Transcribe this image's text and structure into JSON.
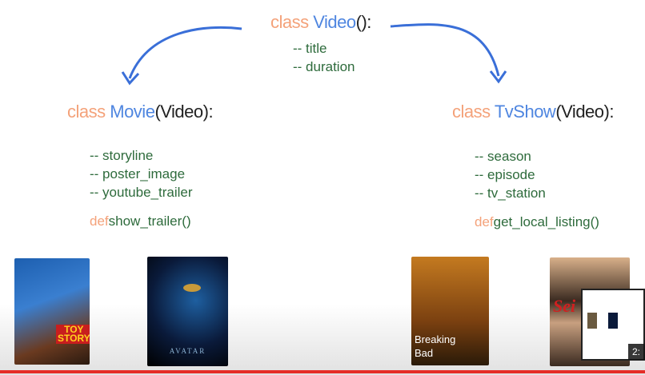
{
  "slide": {
    "video_class": {
      "keyword": "class",
      "name": "Video",
      "suffix": "():",
      "attributes": [
        "-- title",
        "-- duration"
      ]
    },
    "movie_class": {
      "keyword": "class",
      "name": "Movie",
      "suffix": "(Video):",
      "attributes": [
        "-- storyline",
        "-- poster_image",
        "-- youtube_trailer"
      ],
      "method_keyword": "def",
      "method": "show_trailer()"
    },
    "tvshow_class": {
      "keyword": "class",
      "name": "TvShow",
      "suffix": "(Video):",
      "attributes": [
        "-- season",
        "-- episode",
        "-- tv_station"
      ],
      "method_keyword": "def",
      "method": "get_local_listing()"
    },
    "posters": {
      "toy_story": "TOY STORY",
      "avatar": "AVATAR",
      "breaking_bad_1": "Breaking",
      "breaking_bad_2": "Bad",
      "seinfeld": "Sei"
    }
  },
  "player": {
    "timestamp": "2:",
    "progress_percent": 100,
    "progress_color": "#e52d27"
  },
  "colors": {
    "keyword": "#f4a27a",
    "class_name": "#4f86e0",
    "text": "#2e6b3c"
  }
}
